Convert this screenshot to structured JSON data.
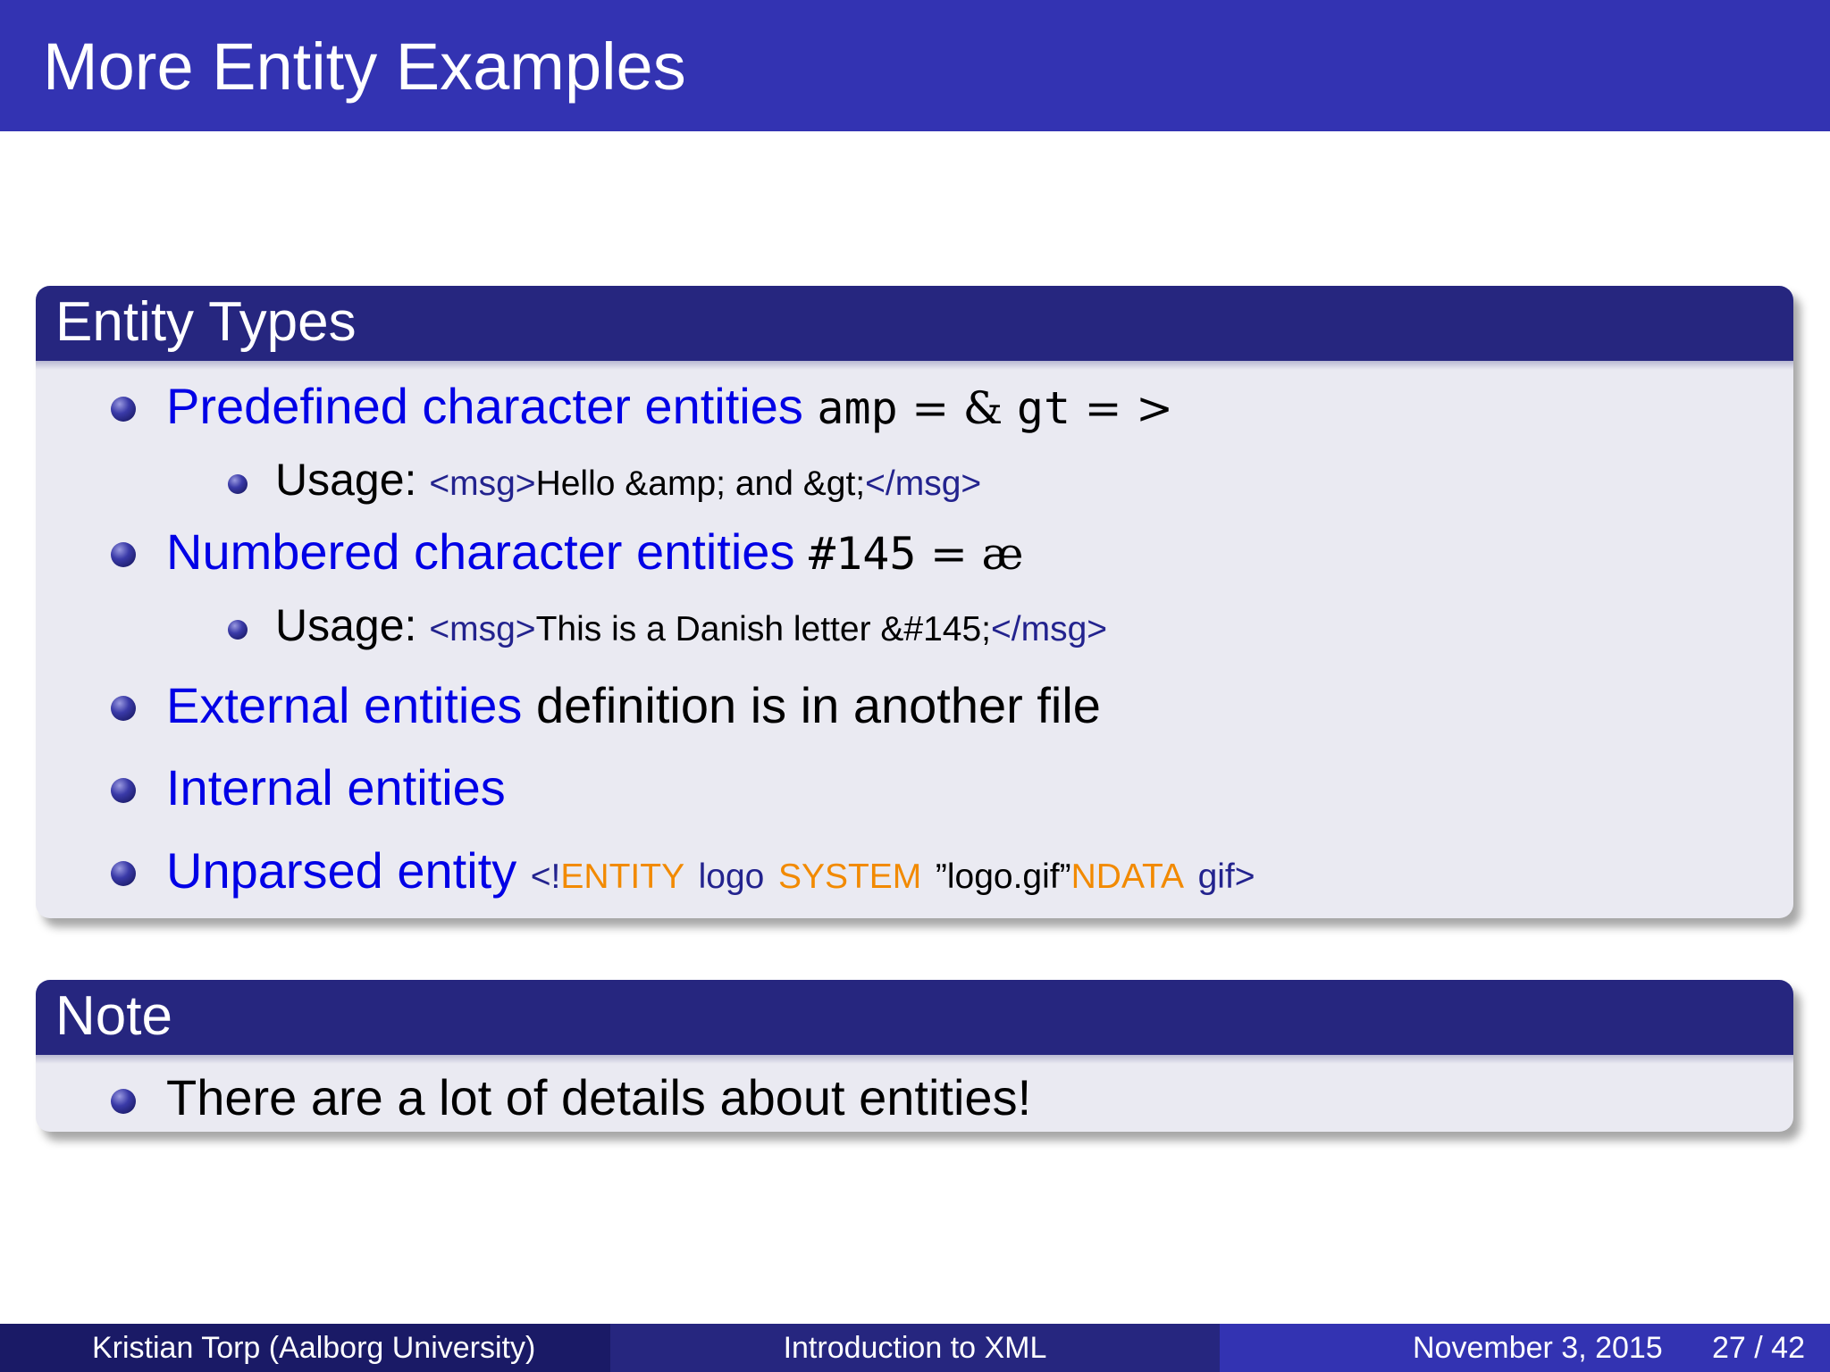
{
  "slide": {
    "title": "More Entity Examples"
  },
  "block_entity_types": {
    "title": "Entity Types",
    "predefined": {
      "label": "Predefined character entities",
      "amp_name": "amp",
      "eq1": "=",
      "amp_char": "&",
      "gt_name": "gt",
      "eq2": "=",
      "gt_char": ">",
      "usage_label": "Usage:",
      "usage_tag_open": "<msg>",
      "usage_text": "Hello &amp; and &gt;",
      "usage_tag_close": "</msg>"
    },
    "numbered": {
      "label": "Numbered character entities",
      "code": "#145",
      "eq": "=",
      "char": "æ",
      "usage_label": "Usage:",
      "usage_tag_open": "<msg>",
      "usage_text": "This is a Danish letter &#145;",
      "usage_tag_close": "</msg>"
    },
    "external": {
      "label": "External entities",
      "text": "definition is in another file"
    },
    "internal": {
      "label": "Internal entities"
    },
    "unparsed": {
      "label": "Unparsed entity",
      "lt_bang": "<!",
      "kw_entity": "ENTITY",
      "name": "logo",
      "kw_system": "SYSTEM",
      "file": "”logo.gif”",
      "kw_ndata": "NDATA",
      "type": "gif",
      "gt": ">"
    }
  },
  "block_note": {
    "title": "Note",
    "item": "There are a lot of details about entities!"
  },
  "footer": {
    "author": "Kristian Torp  (Aalborg University)",
    "course": "Introduction to XML",
    "date": "November 3, 2015",
    "page": "27 / 42"
  },
  "colors": {
    "title_bar": "#3333b2",
    "block_title": "#26267f",
    "block_body": "#eaeaf2",
    "alert_blue": "#0000e6",
    "keyword_orange": "#f28a00",
    "tag_navy": "#23238e",
    "footer_left": "#1a1a66",
    "footer_mid": "#26267f",
    "footer_right": "#3333b2"
  },
  "icons": {
    "bullet": "ball-bullet-icon"
  }
}
